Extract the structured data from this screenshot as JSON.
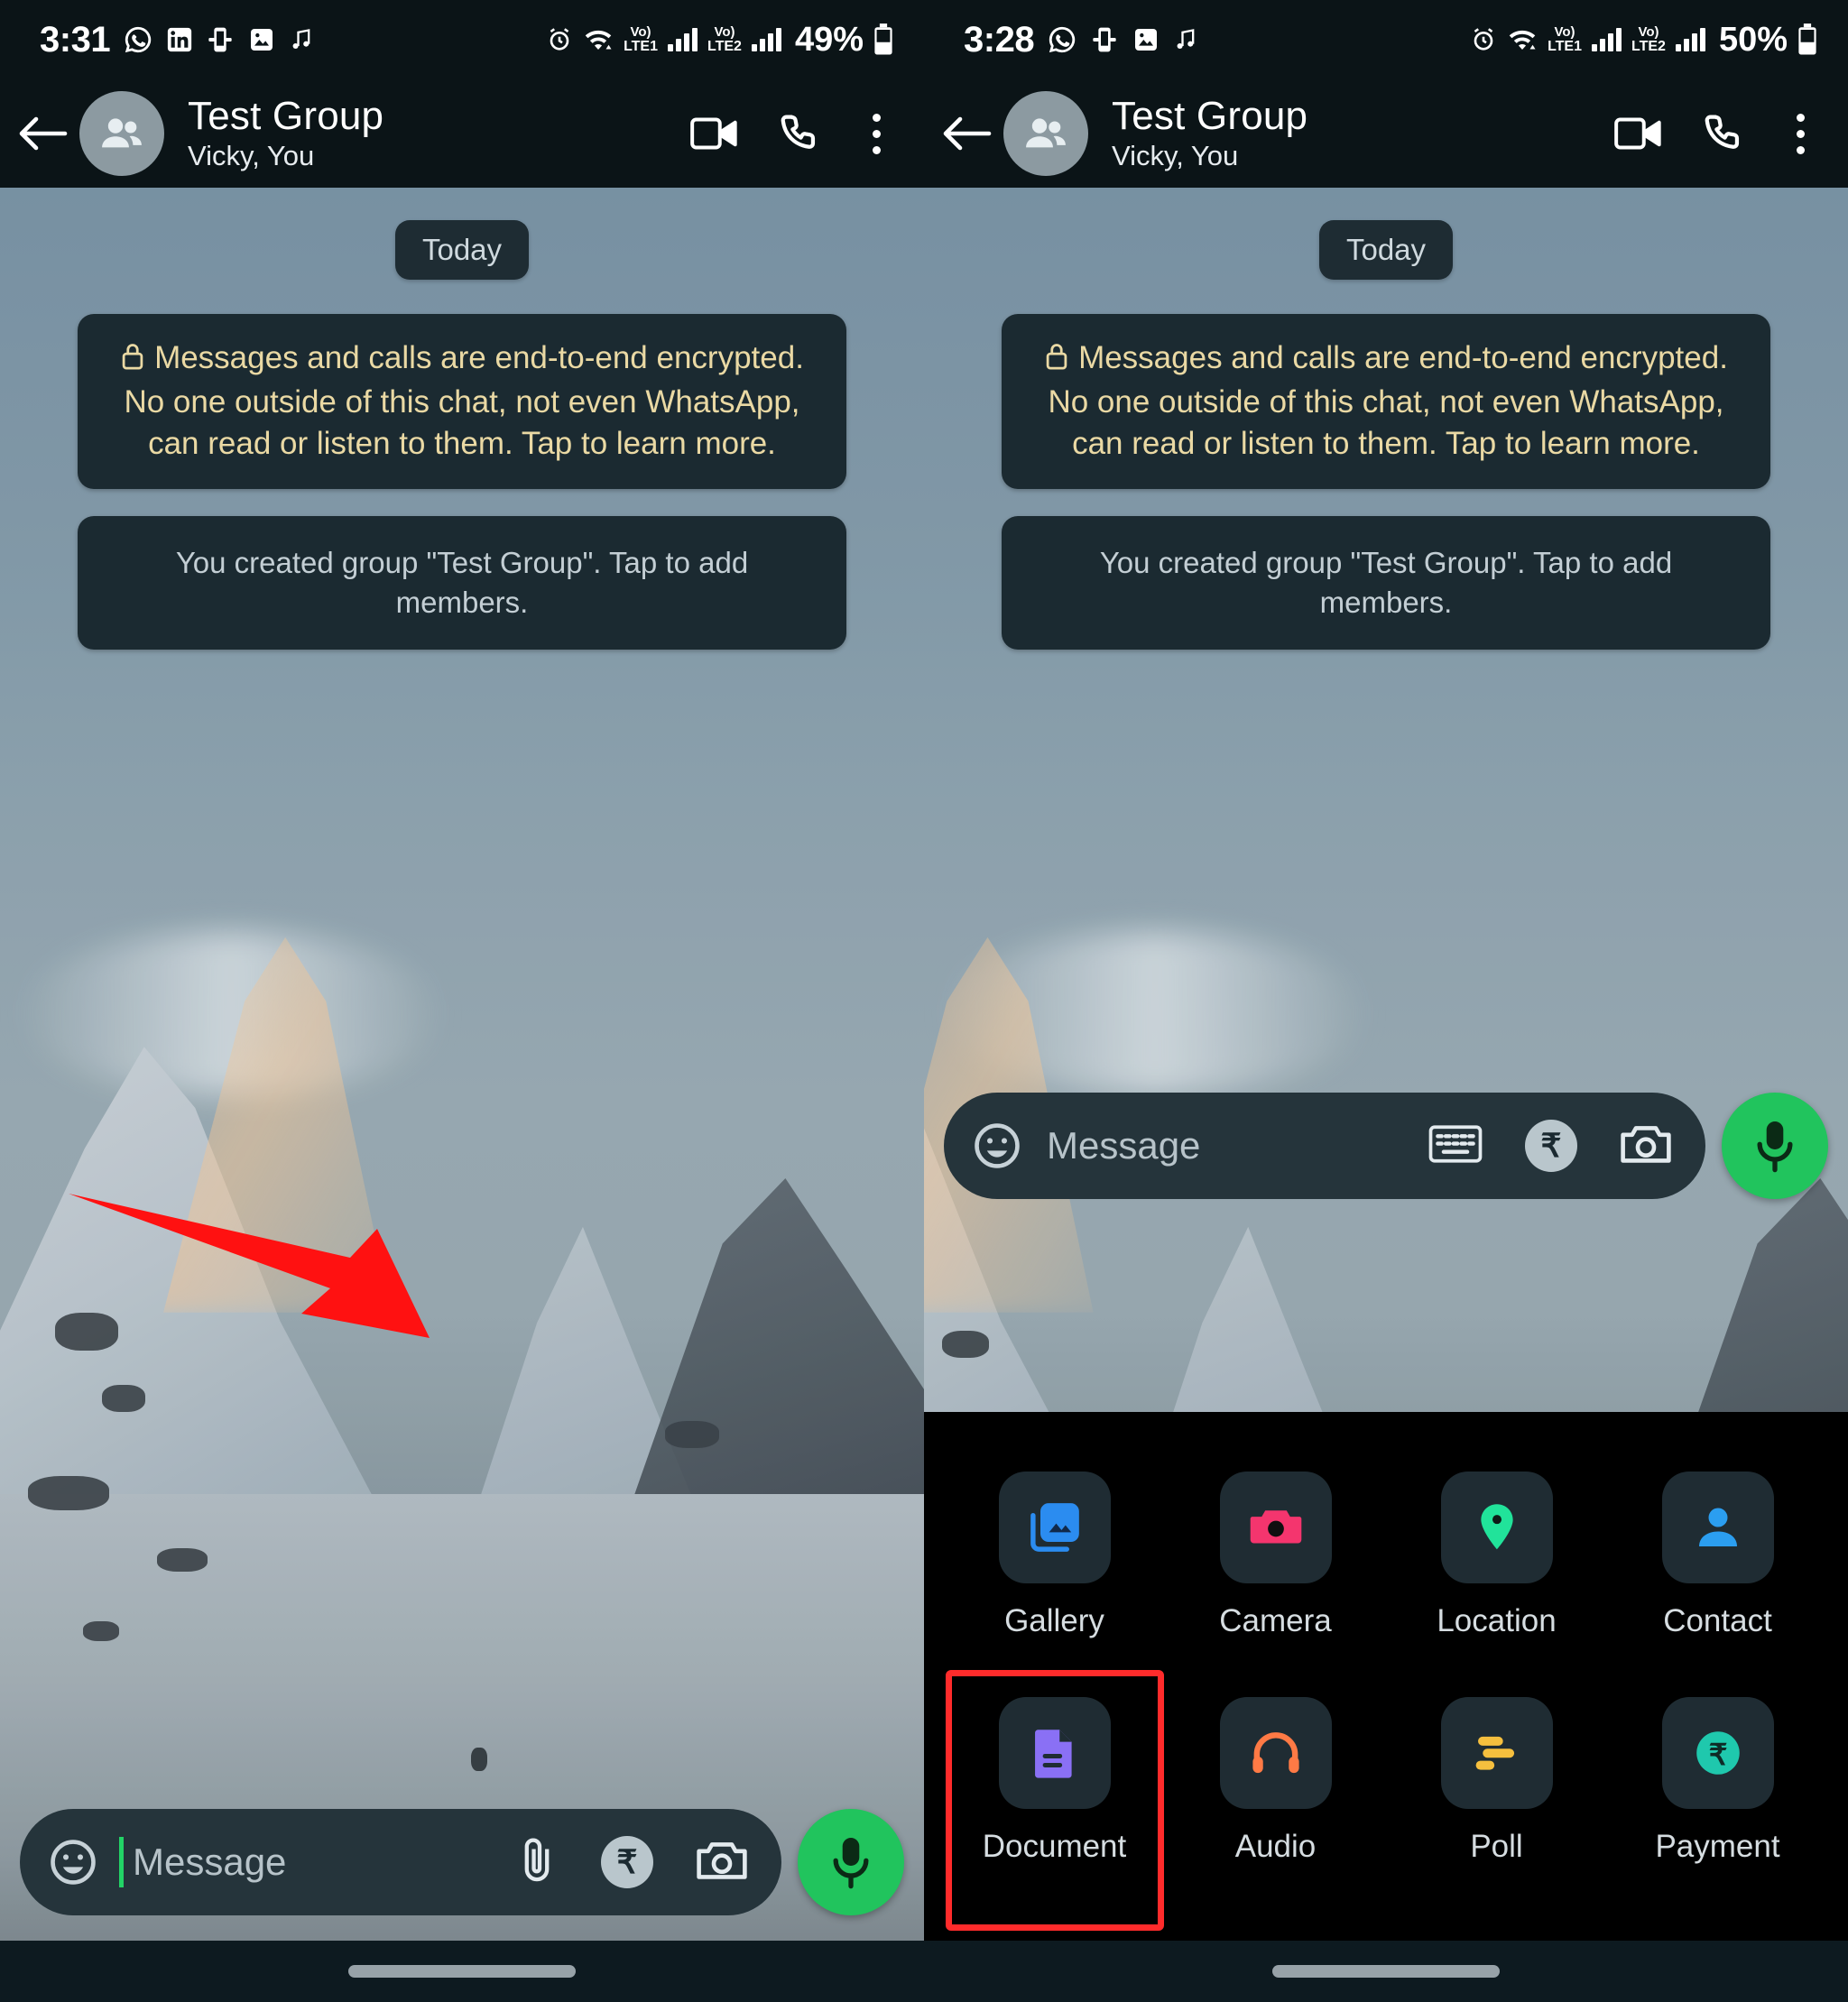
{
  "panels": [
    {
      "id": "left",
      "status": {
        "time": "3:31",
        "battery": "49%",
        "left_icons": [
          "whatsapp-icon",
          "linkedin-icon",
          "phone-link-icon",
          "image-icon",
          "music-note-icon"
        ],
        "right_icons": [
          "alarm-icon",
          "wifi-icon",
          "volte-lte1-icon",
          "signal-bars-icon",
          "volte-lte2-icon",
          "signal-bars-icon",
          "battery-icon"
        ],
        "volte1": {
          "top": "Vo)",
          "bottom": "LTE1"
        },
        "volte2": {
          "top": "Vo)",
          "bottom": "LTE2"
        }
      },
      "appbar": {
        "back": "back-arrow-icon",
        "avatar": "group-avatar-icon",
        "title": "Test Group",
        "subtitle": "Vicky, You",
        "actions": [
          "video-call-icon",
          "voice-call-icon",
          "overflow-menu-icon"
        ]
      },
      "chat": {
        "day_divider": "Today",
        "encryption_notice": "Messages and calls are end-to-end encrypted. No one outside of this chat, not even WhatsApp, can read or listen to them. Tap to learn more.",
        "system_message": "You created group \"Test Group\". Tap to add members."
      },
      "composer": {
        "emoji": "emoji-icon",
        "placeholder": "Message",
        "caret_visible": true,
        "actions": [
          "attach-paperclip-icon",
          "rupee-payment-icon",
          "camera-icon"
        ],
        "rupee": "₹",
        "mic": "microphone-icon"
      },
      "annotation": {
        "type": "red-arrow",
        "points_to": "attach-paperclip-icon"
      },
      "sheet_open": false
    },
    {
      "id": "right",
      "status": {
        "time": "3:28",
        "battery": "50%",
        "left_icons": [
          "whatsapp-icon",
          "phone-link-icon",
          "image-icon",
          "music-note-icon"
        ],
        "right_icons": [
          "alarm-icon",
          "wifi-icon",
          "volte-lte1-icon",
          "signal-bars-icon",
          "volte-lte2-icon",
          "signal-bars-icon",
          "battery-icon"
        ],
        "volte1": {
          "top": "Vo)",
          "bottom": "LTE1"
        },
        "volte2": {
          "top": "Vo)",
          "bottom": "LTE2"
        }
      },
      "appbar": {
        "back": "back-arrow-icon",
        "avatar": "group-avatar-icon",
        "title": "Test Group",
        "subtitle": "Vicky, You",
        "actions": [
          "video-call-icon",
          "voice-call-icon",
          "overflow-menu-icon"
        ]
      },
      "chat": {
        "day_divider": "Today",
        "encryption_notice": "Messages and calls are end-to-end encrypted. No one outside of this chat, not even WhatsApp, can read or listen to them. Tap to learn more.",
        "system_message": "You created group \"Test Group\". Tap to add members."
      },
      "composer": {
        "emoji": "emoji-icon",
        "placeholder": "Message",
        "caret_visible": false,
        "actions": [
          "keyboard-icon",
          "rupee-payment-icon",
          "camera-icon"
        ],
        "rupee": "₹",
        "mic": "microphone-icon"
      },
      "sheet_open": true,
      "attachment_sheet": {
        "items": [
          {
            "label": "Gallery",
            "icon": "gallery-icon",
            "color": "#2b8cf0",
            "selected": false
          },
          {
            "label": "Camera",
            "icon": "camera-icon",
            "color": "#f4356e",
            "selected": false
          },
          {
            "label": "Location",
            "icon": "location-pin-icon",
            "color": "#21e39a",
            "selected": false
          },
          {
            "label": "Contact",
            "icon": "contact-person-icon",
            "color": "#2b9ef0",
            "selected": false
          },
          {
            "label": "Document",
            "icon": "document-icon",
            "color": "#8a70f5",
            "selected": true
          },
          {
            "label": "Audio",
            "icon": "headphones-icon",
            "color": "#ff7a45",
            "selected": false
          },
          {
            "label": "Poll",
            "icon": "poll-bars-icon",
            "color": "#f5bf3e",
            "selected": false
          },
          {
            "label": "Payment",
            "icon": "rupee-coin-icon",
            "color": "#1fc8ad",
            "selected": false
          }
        ]
      }
    }
  ],
  "colors": {
    "appbar_bg": "#0b1417",
    "bubble_bg": "#1b2a31",
    "encryption_text": "#ead9a4",
    "system_text": "#c3ced4",
    "accent_green": "#21c45d",
    "highlight_red": "#ff2b2b",
    "sheet_bg": "#000000",
    "tile_bg": "#1f2c33"
  },
  "navbar": {
    "pill": "home-indicator"
  }
}
